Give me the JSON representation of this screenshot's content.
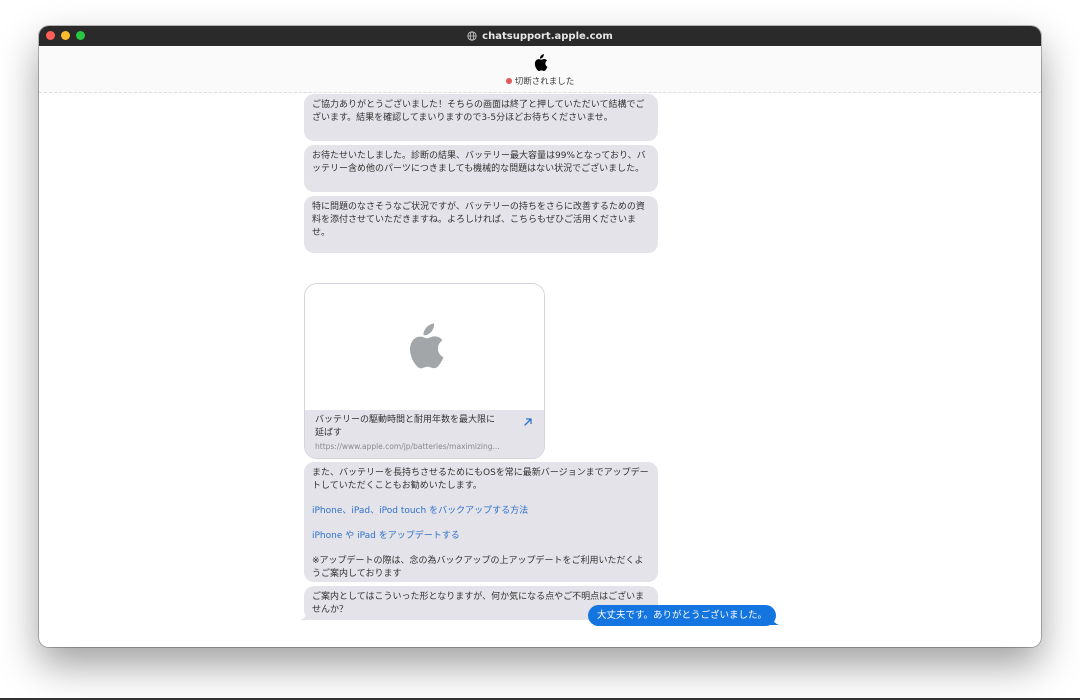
{
  "browser": {
    "url": "chatsupport.apple.com"
  },
  "header": {
    "status": "切断されました",
    "status_color": "#e2565a"
  },
  "messages": {
    "m1": "ご協力ありがとうございました！そちらの画面は終了と押していただいて結構でございます。結果を確認してまいりますので3-5分ほどお待ちくださいませ。",
    "m2": "お待たせいたしました。診断の結果、バッテリー最大容量は99%となっており、バッテリー含め他のパーツにつきましても機械的な問題はない状況でございました。",
    "m3": "特に問題のなさそうなご状況ですが、バッテリーの持ちをさらに改善するための資料を添付させていただきますね。よろしければ、こちらもぜひご活用くださいませ。",
    "card": {
      "title": "バッテリーの駆動時間と耐用年数を最大限に延ばす",
      "url": "https://www.apple.com/jp/batteries/maximizing..."
    },
    "m4": {
      "text": "また、バッテリーを長持ちさせるためにもOSを常に最新バージョンまでアップデートしていただくこともお勧めいたします。",
      "link1": "iPhone、iPad、iPod touch をバックアップする方法",
      "link2": "iPhone や iPad をアップデートする",
      "note": "※アップデートの際は、念の為バックアップの上アップデートをご利用いただくようご案内しております"
    },
    "m5": "ご案内としてはこういった形となりますが、何か気になる点やご不明点はございませんか？",
    "user_reply": "大丈夫です。ありがとうございました。"
  },
  "colors": {
    "agent_bubble": "#e3e3e9",
    "user_bubble": "#1475e1",
    "link": "#2f72c9"
  },
  "icons": {
    "logo": "apple-logo-icon",
    "globe": "globe-icon",
    "external": "external-link-arrow-icon"
  }
}
